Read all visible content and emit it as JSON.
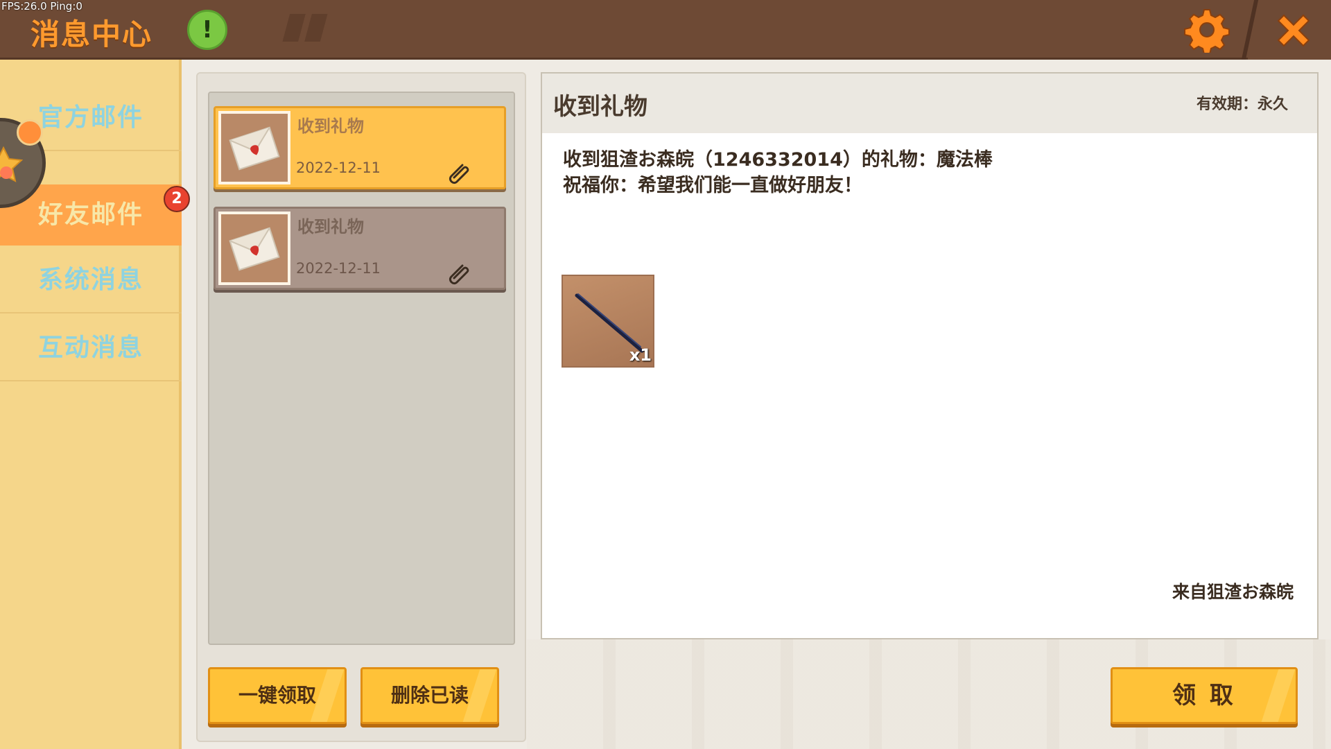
{
  "header": {
    "fps": "FPS:26.0  Ping:0",
    "title": "消息中心",
    "alert_symbol": "!"
  },
  "sidebar": {
    "items": [
      {
        "label": "官方邮件",
        "active": false
      },
      {
        "label": "好友邮件",
        "active": true,
        "badge": "2"
      },
      {
        "label": "系统消息",
        "active": false
      },
      {
        "label": "互动消息",
        "active": false
      }
    ]
  },
  "mail_list": {
    "items": [
      {
        "title": "收到礼物",
        "date": "2022-12-11",
        "state": "selected",
        "icon": "envelope-icon",
        "attachment_icon": "paperclip-icon"
      },
      {
        "title": "收到礼物",
        "date": "2022-12-11",
        "state": "read",
        "icon": "envelope-icon",
        "attachment_icon": "paperclip-icon"
      }
    ],
    "claim_all_label": "一键领取",
    "delete_read_label": "删除已读"
  },
  "detail": {
    "title": "收到礼物",
    "validity": "有效期：永久",
    "body_line1": "收到狙渣お森皖（1246332014）的礼物：魔法棒",
    "body_line2": "祝福你：希望我们能一直做好朋友！",
    "item": {
      "icon": "magic-wand-icon",
      "quantity": "x1"
    },
    "from": "来自狙渣お森皖",
    "claim_label": "领 取"
  },
  "colors": {
    "header_bg": "#6e4a35",
    "title": "#ff9a2e",
    "sidebar_bg": "#f5d68a",
    "sidebar_active": "#ffa54b",
    "button": "#ffc238",
    "badge": "#e9432f"
  }
}
